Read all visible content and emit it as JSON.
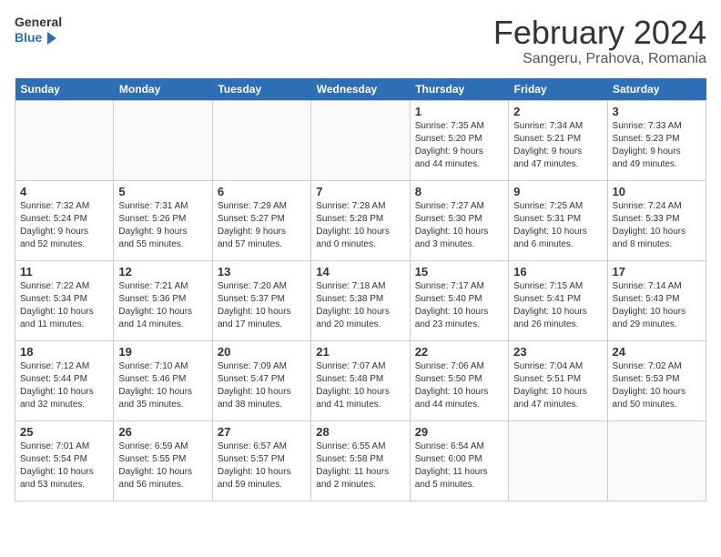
{
  "logo": {
    "text_general": "General",
    "text_blue": "Blue"
  },
  "header": {
    "title": "February 2024",
    "subtitle": "Sangeru, Prahova, Romania"
  },
  "weekdays": [
    "Sunday",
    "Monday",
    "Tuesday",
    "Wednesday",
    "Thursday",
    "Friday",
    "Saturday"
  ],
  "weeks": [
    [
      {
        "day": "",
        "info": ""
      },
      {
        "day": "",
        "info": ""
      },
      {
        "day": "",
        "info": ""
      },
      {
        "day": "",
        "info": ""
      },
      {
        "day": "1",
        "info": "Sunrise: 7:35 AM\nSunset: 5:20 PM\nDaylight: 9 hours\nand 44 minutes."
      },
      {
        "day": "2",
        "info": "Sunrise: 7:34 AM\nSunset: 5:21 PM\nDaylight: 9 hours\nand 47 minutes."
      },
      {
        "day": "3",
        "info": "Sunrise: 7:33 AM\nSunset: 5:23 PM\nDaylight: 9 hours\nand 49 minutes."
      }
    ],
    [
      {
        "day": "4",
        "info": "Sunrise: 7:32 AM\nSunset: 5:24 PM\nDaylight: 9 hours\nand 52 minutes."
      },
      {
        "day": "5",
        "info": "Sunrise: 7:31 AM\nSunset: 5:26 PM\nDaylight: 9 hours\nand 55 minutes."
      },
      {
        "day": "6",
        "info": "Sunrise: 7:29 AM\nSunset: 5:27 PM\nDaylight: 9 hours\nand 57 minutes."
      },
      {
        "day": "7",
        "info": "Sunrise: 7:28 AM\nSunset: 5:28 PM\nDaylight: 10 hours\nand 0 minutes."
      },
      {
        "day": "8",
        "info": "Sunrise: 7:27 AM\nSunset: 5:30 PM\nDaylight: 10 hours\nand 3 minutes."
      },
      {
        "day": "9",
        "info": "Sunrise: 7:25 AM\nSunset: 5:31 PM\nDaylight: 10 hours\nand 6 minutes."
      },
      {
        "day": "10",
        "info": "Sunrise: 7:24 AM\nSunset: 5:33 PM\nDaylight: 10 hours\nand 8 minutes."
      }
    ],
    [
      {
        "day": "11",
        "info": "Sunrise: 7:22 AM\nSunset: 5:34 PM\nDaylight: 10 hours\nand 11 minutes."
      },
      {
        "day": "12",
        "info": "Sunrise: 7:21 AM\nSunset: 5:36 PM\nDaylight: 10 hours\nand 14 minutes."
      },
      {
        "day": "13",
        "info": "Sunrise: 7:20 AM\nSunset: 5:37 PM\nDaylight: 10 hours\nand 17 minutes."
      },
      {
        "day": "14",
        "info": "Sunrise: 7:18 AM\nSunset: 5:38 PM\nDaylight: 10 hours\nand 20 minutes."
      },
      {
        "day": "15",
        "info": "Sunrise: 7:17 AM\nSunset: 5:40 PM\nDaylight: 10 hours\nand 23 minutes."
      },
      {
        "day": "16",
        "info": "Sunrise: 7:15 AM\nSunset: 5:41 PM\nDaylight: 10 hours\nand 26 minutes."
      },
      {
        "day": "17",
        "info": "Sunrise: 7:14 AM\nSunset: 5:43 PM\nDaylight: 10 hours\nand 29 minutes."
      }
    ],
    [
      {
        "day": "18",
        "info": "Sunrise: 7:12 AM\nSunset: 5:44 PM\nDaylight: 10 hours\nand 32 minutes."
      },
      {
        "day": "19",
        "info": "Sunrise: 7:10 AM\nSunset: 5:46 PM\nDaylight: 10 hours\nand 35 minutes."
      },
      {
        "day": "20",
        "info": "Sunrise: 7:09 AM\nSunset: 5:47 PM\nDaylight: 10 hours\nand 38 minutes."
      },
      {
        "day": "21",
        "info": "Sunrise: 7:07 AM\nSunset: 5:48 PM\nDaylight: 10 hours\nand 41 minutes."
      },
      {
        "day": "22",
        "info": "Sunrise: 7:06 AM\nSunset: 5:50 PM\nDaylight: 10 hours\nand 44 minutes."
      },
      {
        "day": "23",
        "info": "Sunrise: 7:04 AM\nSunset: 5:51 PM\nDaylight: 10 hours\nand 47 minutes."
      },
      {
        "day": "24",
        "info": "Sunrise: 7:02 AM\nSunset: 5:53 PM\nDaylight: 10 hours\nand 50 minutes."
      }
    ],
    [
      {
        "day": "25",
        "info": "Sunrise: 7:01 AM\nSunset: 5:54 PM\nDaylight: 10 hours\nand 53 minutes."
      },
      {
        "day": "26",
        "info": "Sunrise: 6:59 AM\nSunset: 5:55 PM\nDaylight: 10 hours\nand 56 minutes."
      },
      {
        "day": "27",
        "info": "Sunrise: 6:57 AM\nSunset: 5:57 PM\nDaylight: 10 hours\nand 59 minutes."
      },
      {
        "day": "28",
        "info": "Sunrise: 6:55 AM\nSunset: 5:58 PM\nDaylight: 11 hours\nand 2 minutes."
      },
      {
        "day": "29",
        "info": "Sunrise: 6:54 AM\nSunset: 6:00 PM\nDaylight: 11 hours\nand 5 minutes."
      },
      {
        "day": "",
        "info": ""
      },
      {
        "day": "",
        "info": ""
      }
    ]
  ]
}
